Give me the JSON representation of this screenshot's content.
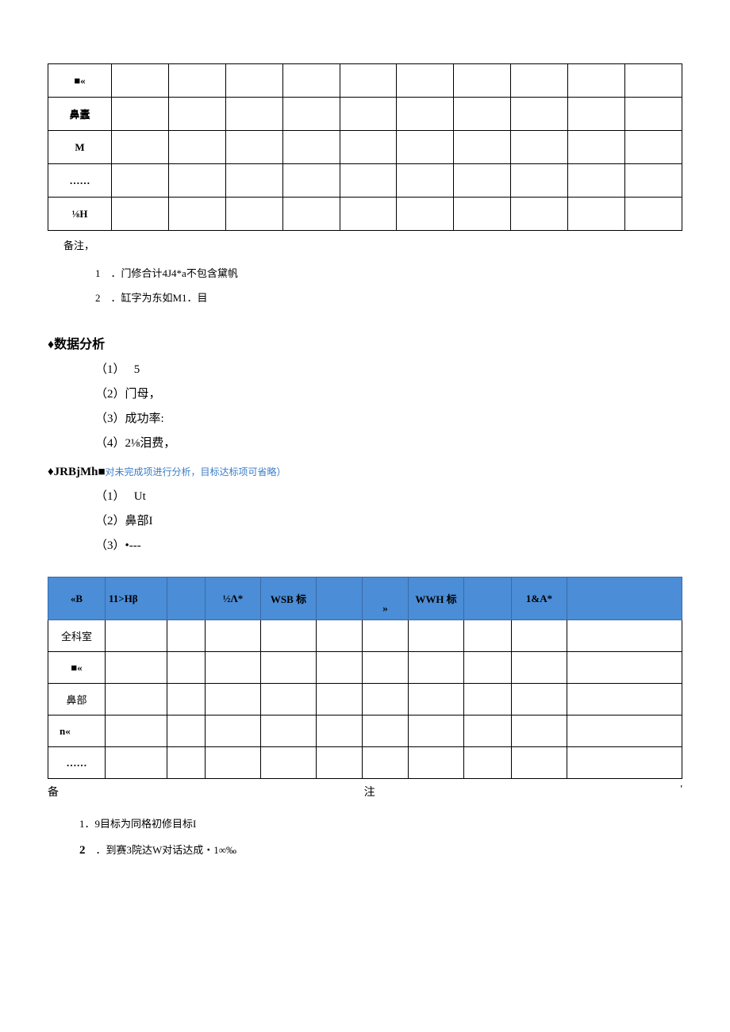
{
  "t1": {
    "rows": [
      "■«",
      "鼻蠹",
      "M",
      "……",
      "⅛H"
    ]
  },
  "notes1": {
    "head": "备注，",
    "items": [
      "1　．门修合计4J4*a不包含黛帆",
      "2　．缸字为东如M1．目"
    ]
  },
  "sec1": {
    "title": "♦数据分析",
    "items": [
      "（1）　 5",
      "（2）门母，",
      "（3）成功率:",
      "（4）2⅛泪费，"
    ]
  },
  "sec2": {
    "title_bold": "♦JRBjMh■",
    "title_note": "对未完成项进行分析，目标达标项可省略）",
    "items": [
      "（1）　 Ut",
      "（2）鼻部I",
      "（3）•---"
    ]
  },
  "t2": {
    "headers": [
      "«B",
      "11>Hβ",
      "",
      "½Λ*",
      "WSB 标",
      "",
      "»",
      "WWH 标",
      "",
      "1&A*",
      ""
    ],
    "rows": [
      "全科室",
      "■«",
      "鼻部",
      "n«",
      "……"
    ]
  },
  "bz": {
    "left": "备",
    "mid": "注",
    "right": "'"
  },
  "foot": {
    "items_prefix": "1．9目标为同格初修目标I",
    "items2_prefix_bold": "2",
    "items2_rest": "　．到赛3院达W对话达成・1∞‰"
  }
}
